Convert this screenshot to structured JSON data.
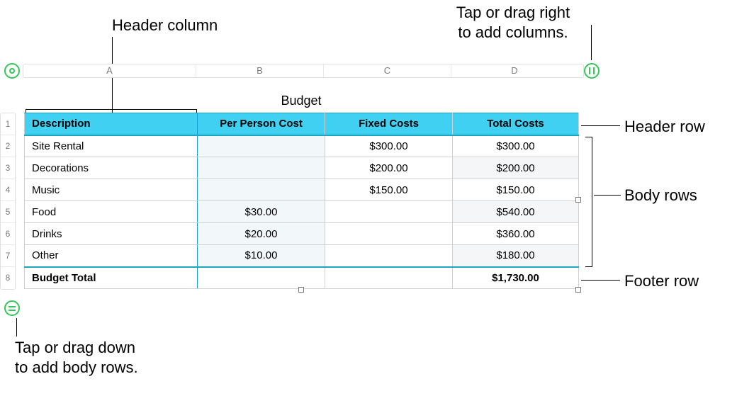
{
  "callouts": {
    "header_column": "Header column",
    "add_columns_l1": "Tap or drag right",
    "add_columns_l2": "to add columns.",
    "header_row": "Header row",
    "body_rows": "Body rows",
    "footer_row": "Footer row",
    "add_rows_l1": "Tap or drag down",
    "add_rows_l2": "to add body rows."
  },
  "sheet": {
    "col_letters": [
      "A",
      "B",
      "C",
      "D"
    ],
    "row_numbers": [
      "1",
      "2",
      "3",
      "4",
      "5",
      "6",
      "7",
      "8"
    ],
    "title": "Budget",
    "headers": [
      "Description",
      "Per Person Cost",
      "Fixed Costs",
      "Total Costs"
    ],
    "rows": [
      {
        "desc": "Site Rental",
        "per": "",
        "fixed": "$300.00",
        "total": "$300.00"
      },
      {
        "desc": "Decorations",
        "per": "",
        "fixed": "$200.00",
        "total": "$200.00"
      },
      {
        "desc": "Music",
        "per": "",
        "fixed": "$150.00",
        "total": "$150.00"
      },
      {
        "desc": "Food",
        "per": "$30.00",
        "fixed": "",
        "total": "$540.00"
      },
      {
        "desc": "Drinks",
        "per": "$20.00",
        "fixed": "",
        "total": "$360.00"
      },
      {
        "desc": "Other",
        "per": "$10.00",
        "fixed": "",
        "total": "$180.00"
      }
    ],
    "footer": {
      "desc": "Budget Total",
      "per": "",
      "fixed": "",
      "total": "$1,730.00"
    }
  },
  "chart_data": {
    "type": "table",
    "title": "Budget",
    "columns": [
      "Description",
      "Per Person Cost",
      "Fixed Costs",
      "Total Costs"
    ],
    "rows": [
      [
        "Site Rental",
        null,
        300.0,
        300.0
      ],
      [
        "Decorations",
        null,
        200.0,
        200.0
      ],
      [
        "Music",
        null,
        150.0,
        150.0
      ],
      [
        "Food",
        30.0,
        null,
        540.0
      ],
      [
        "Drinks",
        20.0,
        null,
        360.0
      ],
      [
        "Other",
        10.0,
        null,
        180.0
      ]
    ],
    "footer": [
      "Budget Total",
      null,
      null,
      1730.0
    ]
  }
}
